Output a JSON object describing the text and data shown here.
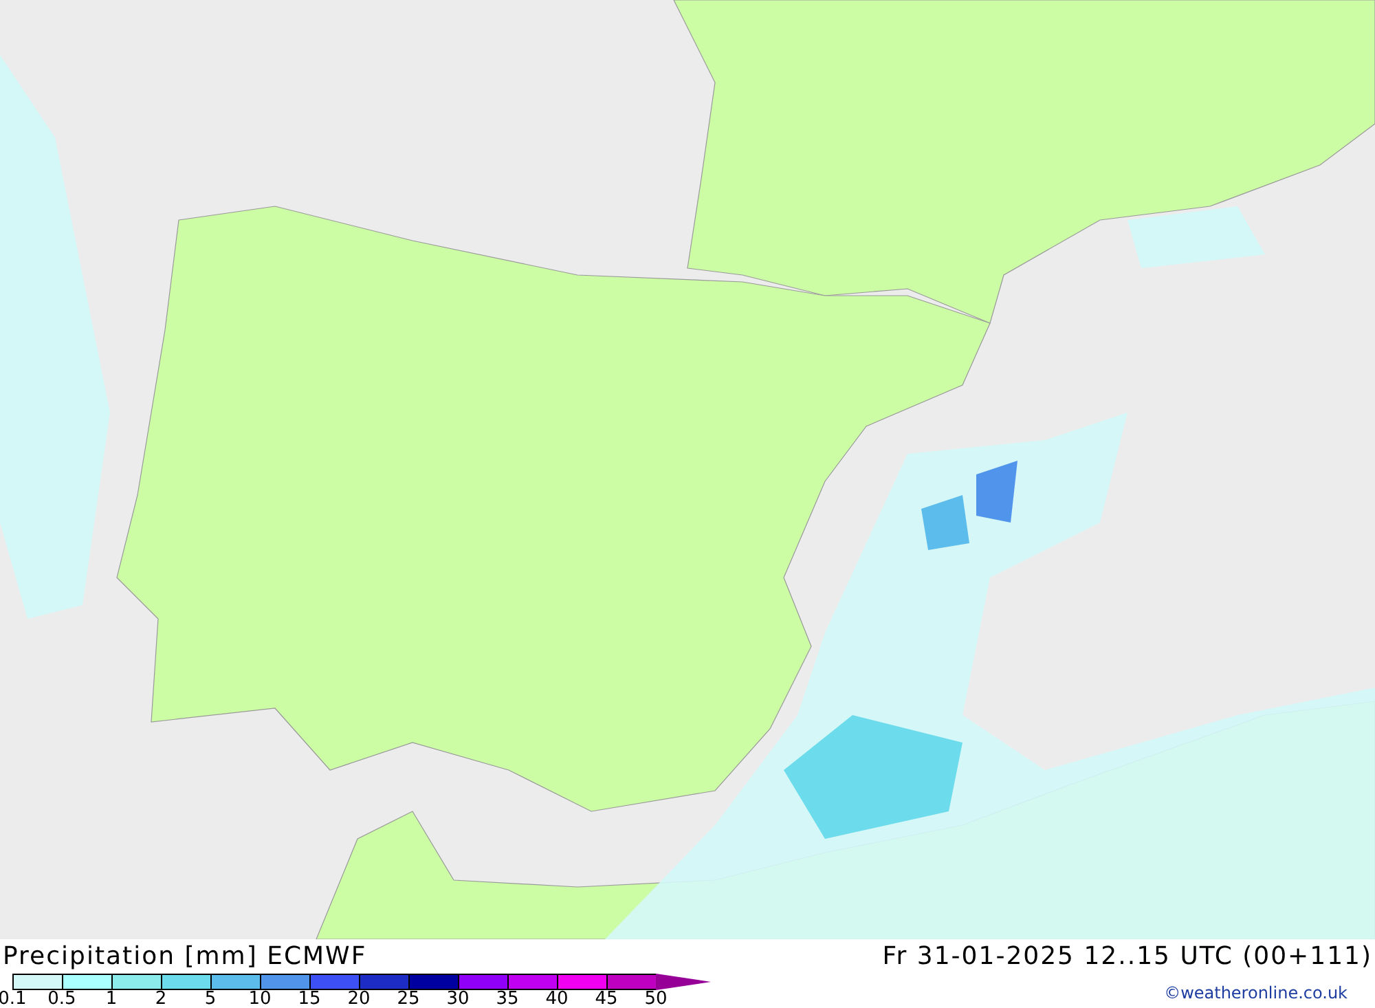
{
  "title": "Precipitation [mm] ECMWF",
  "valid_time": "Fr 31-01-2025 12..15 UTC (00+111)",
  "legend": {
    "swatches": [
      {
        "color": "#d4f8f8"
      },
      {
        "color": "#aaffff"
      },
      {
        "color": "#8cecec"
      },
      {
        "color": "#6cdcec"
      },
      {
        "color": "#5cbcec"
      },
      {
        "color": "#5094ec"
      },
      {
        "color": "#3c50f4"
      },
      {
        "color": "#1c2cc4"
      },
      {
        "color": "#0000a0"
      },
      {
        "color": "#9000f8"
      },
      {
        "color": "#c000f0"
      },
      {
        "color": "#f000f0"
      },
      {
        "color": "#c000c0"
      }
    ],
    "labels": [
      "0.1",
      "0.5",
      "1",
      "2",
      "5",
      "10",
      "15",
      "20",
      "25",
      "30",
      "35",
      "40",
      "45",
      "50"
    ]
  },
  "copyright": "©weatheronline.co.uk"
}
